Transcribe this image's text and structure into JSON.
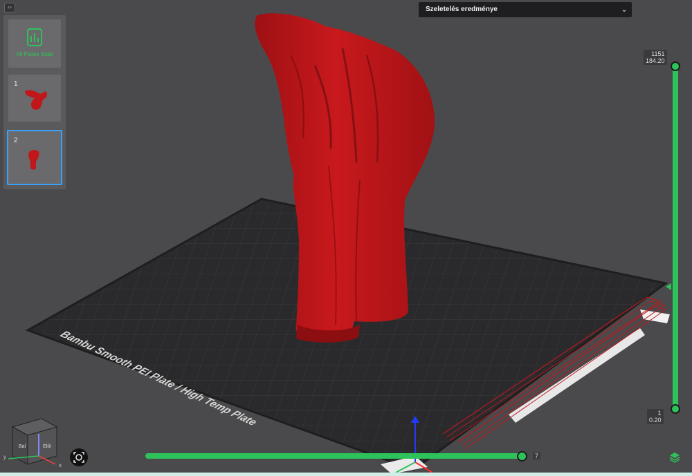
{
  "plates_panel": {
    "all_plates_label": "All Plates Stats",
    "plates": [
      {
        "number": "1",
        "thumbnail": "red-model-1"
      },
      {
        "number": "2",
        "thumbnail": "red-model-2",
        "selected": true
      }
    ]
  },
  "slicing_results": {
    "title": "Szeletelés eredménye",
    "toggle_icon": "double-chevron-down-icon"
  },
  "layer_slider": {
    "top_layer": "1151",
    "top_height": "184.20",
    "bottom_layer": "1",
    "bottom_height": "0.20",
    "accent": "#2ec35a"
  },
  "move_slider": {
    "value": "7"
  },
  "build_plate": {
    "label": "Bambu Smooth PEI Plate / High Temp Plate"
  },
  "view_cube": {
    "faces": [
      "Bal",
      "Elől"
    ],
    "axes": [
      "y",
      "x"
    ]
  },
  "colors": {
    "model": "#c0171b",
    "background": "#4a4a4c",
    "accent": "#2ec35a",
    "selection": "#3aa1ff"
  }
}
